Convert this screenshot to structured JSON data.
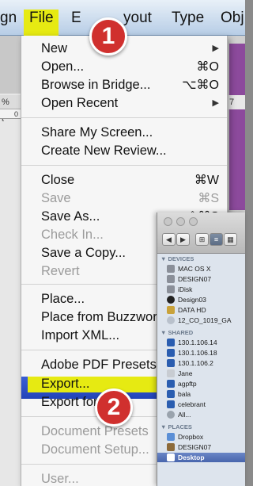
{
  "menubar": {
    "items": [
      "gn",
      "File",
      "E",
      "yout",
      "Type",
      "Obj"
    ]
  },
  "background": {
    "left_tab_label": "% [O",
    "ruler_label": "0",
    "right_tab_label": "7"
  },
  "file_menu": {
    "new": {
      "label": "New"
    },
    "open": {
      "label": "Open...",
      "shortcut": "⌘O"
    },
    "browse": {
      "label": "Browse in Bridge...",
      "shortcut": "⌥⌘O"
    },
    "open_recent": {
      "label": "Open Recent"
    },
    "share": {
      "label": "Share My Screen..."
    },
    "create_review": {
      "label": "Create New Review..."
    },
    "close": {
      "label": "Close",
      "shortcut": "⌘W"
    },
    "save": {
      "label": "Save",
      "shortcut": "⌘S"
    },
    "save_as": {
      "label": "Save As...",
      "shortcut": "⇧⌘S"
    },
    "check_in": {
      "label": "Check In..."
    },
    "save_copy": {
      "label": "Save a Copy..."
    },
    "revert": {
      "label": "Revert"
    },
    "place": {
      "label": "Place..."
    },
    "place_buzz": {
      "label": "Place from Buzzword..."
    },
    "import_xml": {
      "label": "Import XML..."
    },
    "pdf_presets": {
      "label": "Adobe PDF Presets"
    },
    "export": {
      "label": "Export..."
    },
    "export_for": {
      "label": "Export for"
    },
    "doc_presets": {
      "label": "Document Presets"
    },
    "doc_setup": {
      "label": "Document Setup..."
    },
    "user": {
      "label": "User..."
    }
  },
  "badges": {
    "one": "1",
    "two": "2"
  },
  "finder": {
    "buttons": [
      "◀",
      "▶",
      "⊞",
      "≡",
      "▦"
    ],
    "devices_heading": "▼ DEVICES",
    "devices": [
      "MAC OS X",
      "DESIGN07",
      "iDisk",
      "Design03",
      "DATA HD",
      "12_CO_1019_GA"
    ],
    "shared_heading": "▼ SHARED",
    "shared": [
      "130.1.106.14",
      "130.1.106.18",
      "130.1.106.2",
      "Jane",
      "agpftp",
      "bala",
      "celebrant",
      "All..."
    ],
    "places_heading": "▼ PLACES",
    "places": [
      "Dropbox",
      "DESIGN07",
      "Desktop"
    ]
  },
  "colors": {
    "highlight": "#2244b8",
    "annotation_yellow": "#e6ea12",
    "badge_red": "#d0302e"
  }
}
